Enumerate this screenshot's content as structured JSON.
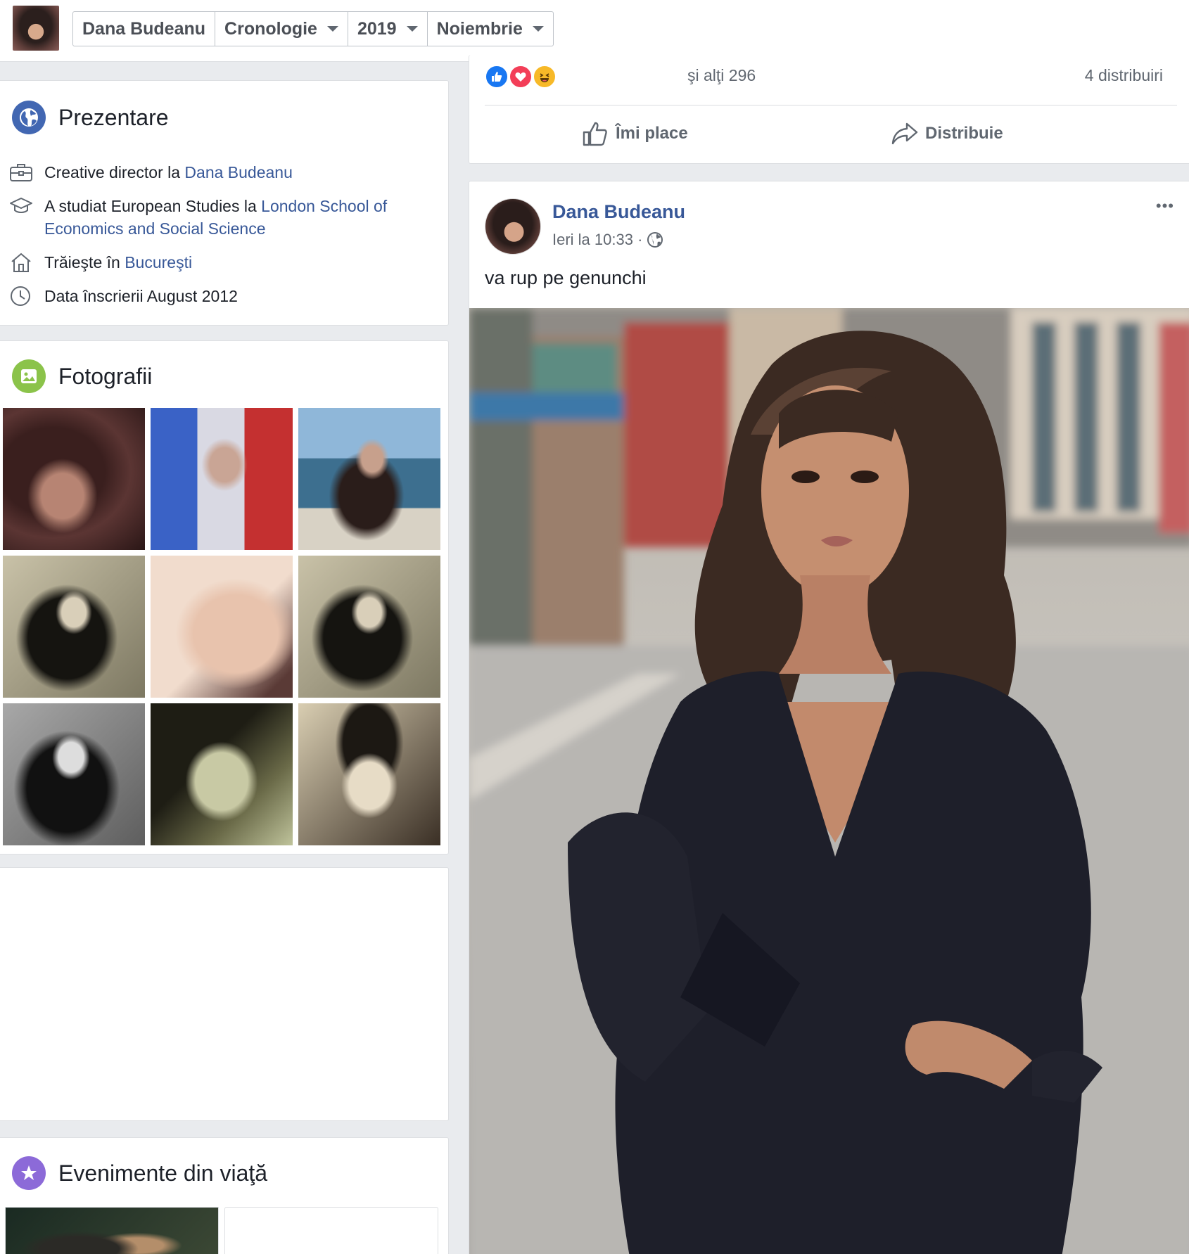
{
  "topbar": {
    "crumbs": [
      {
        "label": "Dana Budeanu",
        "dropdown": false
      },
      {
        "label": "Cronologie",
        "dropdown": true
      },
      {
        "label": "2019",
        "dropdown": true
      },
      {
        "label": "Noiembrie",
        "dropdown": true
      }
    ]
  },
  "intro": {
    "title": "Prezentare",
    "work_prefix": "Creative director la ",
    "work_link": "Dana Budeanu",
    "edu_prefix": "A studiat European Studies la ",
    "edu_link_1": "London School of",
    "edu_link_2": "Economics and Social Science",
    "lives_prefix": "Trăieşte în ",
    "lives_link": "Bucureşti",
    "joined": "Data înscrierii August 2012"
  },
  "photos": {
    "title": "Fotografii"
  },
  "life_events": {
    "title": "Evenimente din viaţă"
  },
  "prev_post": {
    "others": "şi alţi 296",
    "shares": "4 distribuiri",
    "like_label": "Îmi place",
    "share_label": "Distribuie"
  },
  "post": {
    "author": "Dana Budeanu",
    "time": "Ieri la 10:33 · ",
    "text": "va rup pe genunchi",
    "more": "•••"
  },
  "colors": {
    "link": "#385898",
    "globe_icon_bg": "#4267b2",
    "photos_icon_bg": "#8bc34a",
    "events_icon_bg": "#8c6ad8",
    "like_blue": "#1877f2",
    "love_red": "#f33e58",
    "haha_yellow": "#f7b928"
  }
}
